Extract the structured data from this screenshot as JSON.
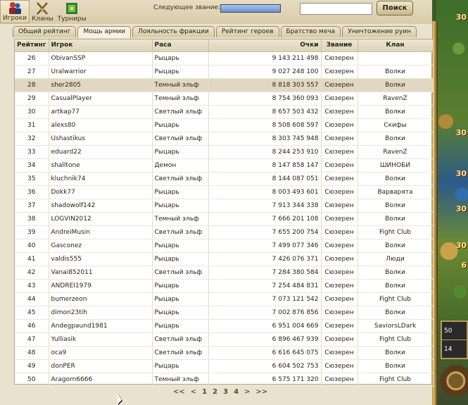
{
  "topnav": [
    {
      "label": "Игроки",
      "icon": "players-icon",
      "active": true
    },
    {
      "label": "Кланы",
      "icon": "clans-icon",
      "active": false
    },
    {
      "label": "Турниры",
      "icon": "tournaments-icon",
      "active": false
    }
  ],
  "header": {
    "next_rank_label": "Следующее звание:",
    "progress": 1.0,
    "search_placeholder": "",
    "search_button": "Поиск"
  },
  "tabs": [
    {
      "label": "Общий рейтинг",
      "active": false
    },
    {
      "label": "Мощь армии",
      "active": true
    },
    {
      "label": "Лояльность фракции",
      "active": false
    },
    {
      "label": "Рейтинг героев",
      "active": false
    },
    {
      "label": "Братство меча",
      "active": false
    },
    {
      "label": "Уничтожение руин",
      "active": false
    }
  ],
  "columns": {
    "rank": "Рейтинг",
    "player": "Игрок",
    "race": "Раса",
    "score": "Очки",
    "title": "Звание",
    "clan": "Клан"
  },
  "rows": [
    {
      "rank": "26",
      "player": "ObivanSSP",
      "race": "Рыцарь",
      "score": "9 143 211 498",
      "title": "Сюзерен",
      "clan": ""
    },
    {
      "rank": "27",
      "player": "Uralwarrior",
      "race": "Рыцарь",
      "score": "9 027 248 100",
      "title": "Сюзерен",
      "clan": "Волки"
    },
    {
      "rank": "28",
      "player": "sher2805",
      "race": "Темный эльф",
      "score": "8 818 303 557",
      "title": "Сюзерен",
      "clan": "Волки"
    },
    {
      "rank": "29",
      "player": "CasualPlayer",
      "race": "Темный эльф",
      "score": "8 754 360 093",
      "title": "Сюзерен",
      "clan": "RavenZ"
    },
    {
      "rank": "30",
      "player": "artkap77",
      "race": "Светлый эльф",
      "score": "8 657 503 432",
      "title": "Сюзерен",
      "clan": "Волки"
    },
    {
      "rank": "31",
      "player": "alexs80",
      "race": "Рыцарь",
      "score": "8 508 608 597",
      "title": "Сюзерен",
      "clan": "Скифы"
    },
    {
      "rank": "32",
      "player": "Ushastikus",
      "race": "Светлый эльф",
      "score": "8 303 745 948",
      "title": "Сюзерен",
      "clan": "Волки"
    },
    {
      "rank": "33",
      "player": "eduard22",
      "race": "Рыцарь",
      "score": "8 244 253 910",
      "title": "Сюзерен",
      "clan": "RavenZ"
    },
    {
      "rank": "34",
      "player": "shalltone",
      "race": "Демон",
      "score": "8 147 858 147",
      "title": "Сюзерен",
      "clan": "ШИНОБИ"
    },
    {
      "rank": "35",
      "player": "kluchnik74",
      "race": "Светлый эльф",
      "score": "8 144 087 051",
      "title": "Сюзерен",
      "clan": "Волки"
    },
    {
      "rank": "36",
      "player": "Dokk77",
      "race": "Рыцарь",
      "score": "8 003 493 601",
      "title": "Сюзерен",
      "clan": "Варварята"
    },
    {
      "rank": "37",
      "player": "shadowolf142",
      "race": "Рыцарь",
      "score": "7 913 344 338",
      "title": "Сюзерен",
      "clan": "Волки"
    },
    {
      "rank": "38",
      "player": "LOGVIN2012",
      "race": "Темный эльф",
      "score": "7 666 201 108",
      "title": "Сюзерен",
      "clan": "Волки"
    },
    {
      "rank": "39",
      "player": "AndreiMusin",
      "race": "Светлый эльф",
      "score": "7 655 200 754",
      "title": "Сюзерен",
      "clan": "Fight Club"
    },
    {
      "rank": "40",
      "player": "Gasconez",
      "race": "Рыцарь",
      "score": "7 499 077 346",
      "title": "Сюзерен",
      "clan": "Волки"
    },
    {
      "rank": "41",
      "player": "valdis555",
      "race": "Рыцарь",
      "score": "7 426 076 371",
      "title": "Сюзерен",
      "clan": "Люди"
    },
    {
      "rank": "42",
      "player": "Vanai852011",
      "race": "Светлый эльф",
      "score": "7 284 380 584",
      "title": "Сюзерен",
      "clan": "Волки"
    },
    {
      "rank": "43",
      "player": "ANDREI1979",
      "race": "Рыцарь",
      "score": "7 254 484 831",
      "title": "Сюзерен",
      "clan": "Волки"
    },
    {
      "rank": "44",
      "player": "bumerzeon",
      "race": "Рыцарь",
      "score": "7 073 121 542",
      "title": "Сюзерен",
      "clan": "Fight Club"
    },
    {
      "rank": "45",
      "player": "dimon23tih",
      "race": "Рыцарь",
      "score": "7 002 876 856",
      "title": "Сюзерен",
      "clan": "Волки"
    },
    {
      "rank": "46",
      "player": "Andegpaund1981",
      "race": "Рыцарь",
      "score": "6 951 004 669",
      "title": "Сюзерен",
      "clan": "SaviorsLDark"
    },
    {
      "rank": "47",
      "player": "Yulliasik",
      "race": "Светлый эльф",
      "score": "6 896 467 939",
      "title": "Сюзерен",
      "clan": "Fight Club"
    },
    {
      "rank": "48",
      "player": "oca9",
      "race": "Светлый эльф",
      "score": "6 616 645 075",
      "title": "Сюзерен",
      "clan": "Волки"
    },
    {
      "rank": "49",
      "player": "donPER",
      "race": "Рыцарь",
      "score": "6 604 502 753",
      "title": "Сюзерен",
      "clan": "Волки"
    },
    {
      "rank": "50",
      "player": "Aragorn6666",
      "race": "Темный эльф",
      "score": "6 575 171 320",
      "title": "Сюзерен",
      "clan": "Fight Club"
    }
  ],
  "highlight_row": 2,
  "pagination": {
    "first": "<<",
    "prev": "<",
    "pages": [
      "1",
      "2",
      "3",
      "4"
    ],
    "current": "2",
    "next": ">",
    "last": ">>"
  },
  "map": {
    "numbers": [
      "30",
      "30",
      "30",
      "30",
      "30",
      "6"
    ],
    "panel_top": "50",
    "panel_bottom": "14"
  },
  "colors": {
    "parchment": "#e9e2cf",
    "highlight": "#e2d8c2",
    "progress": "#8aaee0"
  }
}
